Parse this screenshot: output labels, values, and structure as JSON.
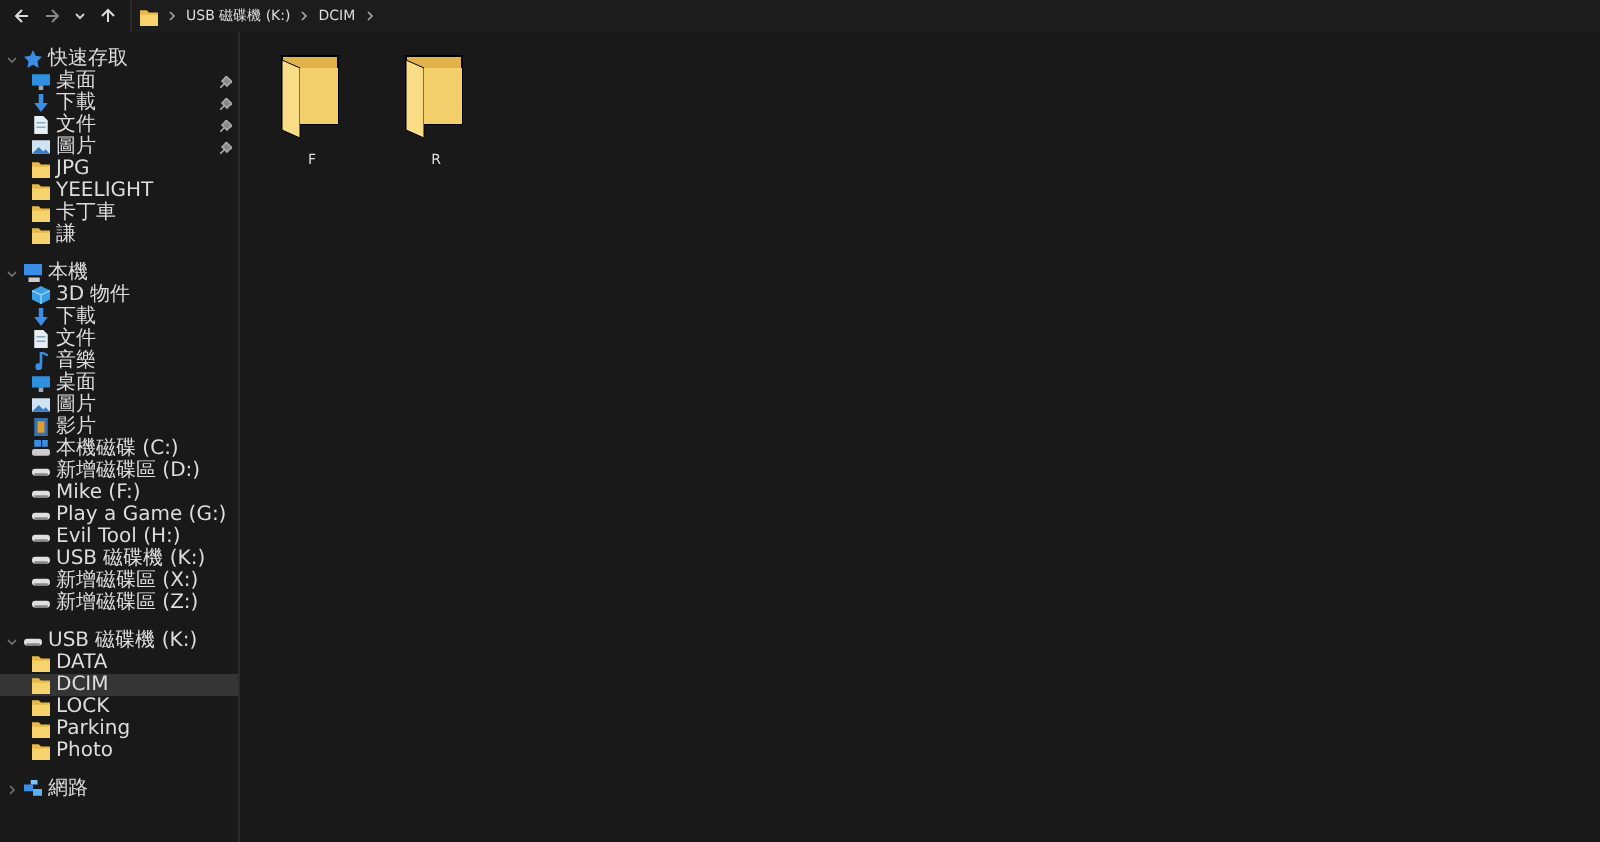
{
  "address_bar": {
    "path": [
      {
        "label": "USB 磁碟機 (K:)"
      },
      {
        "label": "DCIM"
      }
    ]
  },
  "sidebar": {
    "sections": [
      {
        "label": "快速存取",
        "kind": "star",
        "expanded": true,
        "children": [
          {
            "label": "桌面",
            "kind": "desktop",
            "pinned": true,
            "selected": false
          },
          {
            "label": "下載",
            "kind": "download",
            "pinned": true,
            "selected": false
          },
          {
            "label": "文件",
            "kind": "document",
            "pinned": true,
            "selected": false
          },
          {
            "label": "圖片",
            "kind": "image",
            "pinned": true,
            "selected": false
          },
          {
            "label": "JPG",
            "kind": "folder",
            "pinned": false,
            "selected": false
          },
          {
            "label": "YEELIGHT",
            "kind": "folder",
            "pinned": false,
            "selected": false
          },
          {
            "label": "卡丁車",
            "kind": "folder",
            "pinned": false,
            "selected": false
          },
          {
            "label": "謙",
            "kind": "folder",
            "pinned": false,
            "selected": false
          }
        ]
      },
      {
        "label": "本機",
        "kind": "pc",
        "expanded": true,
        "children": [
          {
            "label": "3D 物件",
            "kind": "cube",
            "selected": false
          },
          {
            "label": "下載",
            "kind": "download",
            "selected": false
          },
          {
            "label": "文件",
            "kind": "document",
            "selected": false
          },
          {
            "label": "音樂",
            "kind": "music",
            "selected": false
          },
          {
            "label": "桌面",
            "kind": "desktop",
            "selected": false
          },
          {
            "label": "圖片",
            "kind": "image",
            "selected": false
          },
          {
            "label": "影片",
            "kind": "video",
            "selected": false
          },
          {
            "label": "本機磁碟 (C:)",
            "kind": "systemdrive",
            "selected": false
          },
          {
            "label": "新增磁碟區 (D:)",
            "kind": "drive",
            "selected": false
          },
          {
            "label": "Mike (F:)",
            "kind": "drive",
            "selected": false
          },
          {
            "label": "Play a Game (G:)",
            "kind": "drive",
            "selected": false
          },
          {
            "label": "Evil Tool (H:)",
            "kind": "drive",
            "selected": false
          },
          {
            "label": "USB 磁碟機 (K:)",
            "kind": "drive",
            "selected": false
          },
          {
            "label": "新增磁碟區 (X:)",
            "kind": "drive",
            "selected": false
          },
          {
            "label": "新增磁碟區 (Z:)",
            "kind": "drive",
            "selected": false
          }
        ]
      },
      {
        "label": "USB 磁碟機 (K:)",
        "kind": "drive",
        "expanded": true,
        "children": [
          {
            "label": "DATA",
            "kind": "folder",
            "selected": false
          },
          {
            "label": "DCIM",
            "kind": "folder",
            "selected": true
          },
          {
            "label": "LOCK",
            "kind": "folder",
            "selected": false
          },
          {
            "label": "Parking",
            "kind": "folder",
            "selected": false
          },
          {
            "label": "Photo",
            "kind": "folder",
            "selected": false
          }
        ]
      },
      {
        "label": "網路",
        "kind": "network",
        "expanded": false
      }
    ]
  },
  "content": {
    "items": [
      {
        "name": "F",
        "kind": "folder"
      },
      {
        "name": "R",
        "kind": "folder"
      }
    ]
  }
}
